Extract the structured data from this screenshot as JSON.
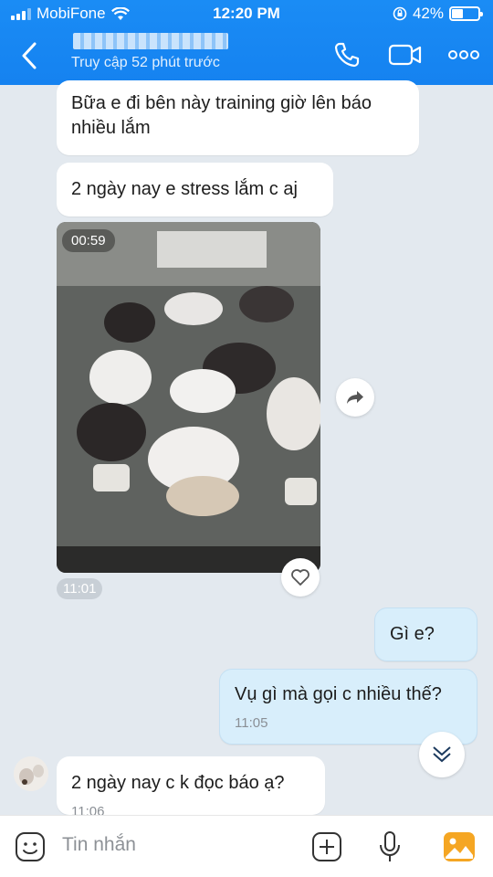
{
  "status_bar": {
    "carrier": "MobiFone",
    "time": "12:20 PM",
    "battery": "42%",
    "battery_level": 0.42
  },
  "header": {
    "contact_status": "Truy cập 52 phút trước",
    "icons": [
      "back-icon",
      "phone-icon",
      "video-call-icon",
      "more-icon"
    ]
  },
  "messages": [
    {
      "from": "them",
      "text": "Bữa e đi bên này training giờ lên báo nhiều lắm"
    },
    {
      "from": "them",
      "text": "2 ngày nay e stress lắm c aj"
    },
    {
      "from": "them",
      "type": "video",
      "duration": "00:59",
      "time": "11:01"
    },
    {
      "from": "me",
      "text": "Gì e?"
    },
    {
      "from": "me",
      "text": "Vụ gì mà gọi c nhiều thế?",
      "time": "11:05"
    },
    {
      "from": "them",
      "text": "2 ngày nay c k đọc báo ạ?",
      "time": "11:06"
    }
  ],
  "composer": {
    "placeholder": "Tin nhắn",
    "icons": [
      "sticker-icon",
      "plus-icon",
      "microphone-icon",
      "image-icon"
    ]
  },
  "colors": {
    "header": "#1582f0",
    "background": "#e3e9ef",
    "my_bubble": "#d8eefb",
    "their_bubble": "#ffffff"
  }
}
